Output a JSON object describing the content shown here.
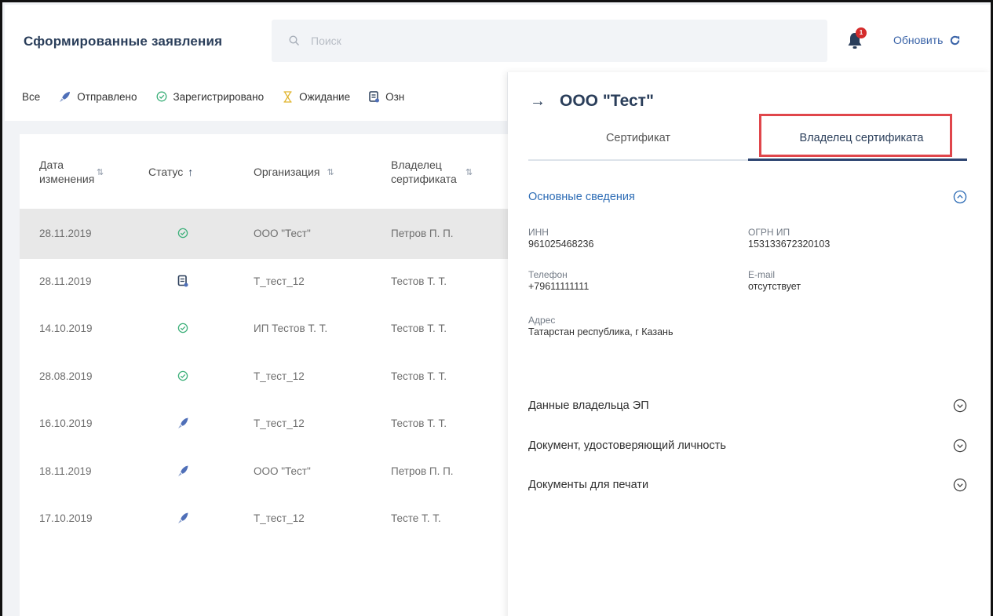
{
  "header": {
    "title": "Сформированные заявления",
    "search_placeholder": "Поиск",
    "notifications_count": "1",
    "refresh_label": "Обновить"
  },
  "filters": [
    {
      "label": "Все",
      "icon": ""
    },
    {
      "label": "Отправлено",
      "icon": "rocket-icon"
    },
    {
      "label": "Зарегистрировано",
      "icon": "check-circle-icon"
    },
    {
      "label": "Ожидание",
      "icon": "hourglass-icon"
    },
    {
      "label": "Озн",
      "icon": "document-icon"
    }
  ],
  "table": {
    "columns": [
      "Дата изменения",
      "Статус",
      "Организация",
      "Владелец сертификата"
    ],
    "rows": [
      {
        "date": "28.11.2019",
        "status": "registered",
        "org": "ООО \"Тест\"",
        "owner": "Петров П. П.",
        "selected": true
      },
      {
        "date": "28.11.2019",
        "status": "document",
        "org": "Т_тест_12",
        "owner": "Тестов Т. Т."
      },
      {
        "date": "14.10.2019",
        "status": "registered",
        "org": "ИП Тестов Т. Т.",
        "owner": "Тестов Т. Т."
      },
      {
        "date": "28.08.2019",
        "status": "registered",
        "org": "Т_тест_12",
        "owner": "Тестов Т. Т."
      },
      {
        "date": "16.10.2019",
        "status": "sent",
        "org": "Т_тест_12",
        "owner": "Тестов Т. Т."
      },
      {
        "date": "18.11.2019",
        "status": "sent",
        "org": "ООО \"Тест\"",
        "owner": "Петров П. П."
      },
      {
        "date": "17.10.2019",
        "status": "sent",
        "org": "Т_тест_12",
        "owner": "Тесте Т. Т."
      }
    ]
  },
  "panel": {
    "title": "ООО \"Тест\"",
    "tabs": [
      "Сертификат",
      "Владелец сертификата"
    ],
    "active_tab": "Владелец сертификата",
    "section": "Основные сведения",
    "fields": {
      "inn_label": "ИНН",
      "inn_value": "961025468236",
      "ogrn_label": "ОГРН ИП",
      "ogrn_value": "153133672320103",
      "phone_label": "Телефон",
      "phone_value": "+79611111111",
      "email_label": "E-mail",
      "email_value": "отсутствует",
      "address_label": "Адрес",
      "address_value": "Татарстан республика, г Казань"
    },
    "accordions": [
      "Данные владельца ЭП",
      "Документ, удостоверяющий личность",
      "Документы для печати"
    ]
  },
  "colors": {
    "accent": "#2d6cb5",
    "title": "#2a3e5a",
    "registered": "#3db07a",
    "sent": "#4f6fb8",
    "badge": "#d42c2c",
    "highlight": "#e0464b"
  }
}
